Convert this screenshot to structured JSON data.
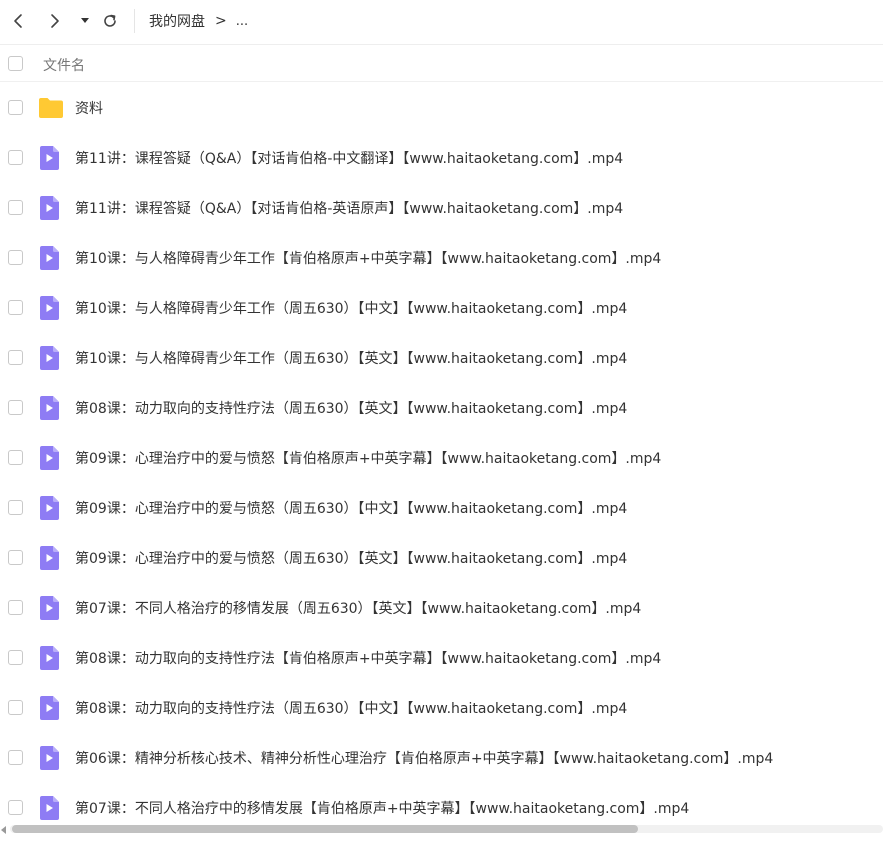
{
  "toolbar": {
    "breadcrumb_root": "我的网盘",
    "breadcrumb_sep": ">",
    "breadcrumb_more": "..."
  },
  "header": {
    "column_name": "文件名"
  },
  "colors": {
    "folder": "#FFC933",
    "video": "#8E7CF4",
    "scroll_thumb": "#C1C1C1"
  },
  "files": [
    {
      "name": "资料",
      "type": "folder",
      "icon": "folder-icon"
    },
    {
      "name": "第11讲：课程答疑（Q&A）【对话肯伯格-中文翻译】【www.haitaoketang.com】.mp4",
      "type": "video",
      "icon": "video-file-icon"
    },
    {
      "name": "第11讲：课程答疑（Q&A）【对话肯伯格-英语原声】【www.haitaoketang.com】.mp4",
      "type": "video",
      "icon": "video-file-icon"
    },
    {
      "name": "第10课：与人格障碍青少年工作【肯伯格原声+中英字幕】【www.haitaoketang.com】.mp4",
      "type": "video",
      "icon": "video-file-icon"
    },
    {
      "name": "第10课：与人格障碍青少年工作（周五630）【中文】【www.haitaoketang.com】.mp4",
      "type": "video",
      "icon": "video-file-icon"
    },
    {
      "name": "第10课：与人格障碍青少年工作（周五630）【英文】【www.haitaoketang.com】.mp4",
      "type": "video",
      "icon": "video-file-icon"
    },
    {
      "name": "第08课：动力取向的支持性疗法（周五630）【英文】【www.haitaoketang.com】.mp4",
      "type": "video",
      "icon": "video-file-icon"
    },
    {
      "name": "第09课：心理治疗中的爱与愤怒【肯伯格原声+中英字幕】【www.haitaoketang.com】.mp4",
      "type": "video",
      "icon": "video-file-icon"
    },
    {
      "name": "第09课：心理治疗中的爱与愤怒（周五630）【中文】【www.haitaoketang.com】.mp4",
      "type": "video",
      "icon": "video-file-icon"
    },
    {
      "name": "第09课：心理治疗中的爱与愤怒（周五630）【英文】【www.haitaoketang.com】.mp4",
      "type": "video",
      "icon": "video-file-icon"
    },
    {
      "name": "第07课：不同人格治疗的移情发展（周五630）【英文】【www.haitaoketang.com】.mp4",
      "type": "video",
      "icon": "video-file-icon"
    },
    {
      "name": "第08课：动力取向的支持性疗法【肯伯格原声+中英字幕】【www.haitaoketang.com】.mp4",
      "type": "video",
      "icon": "video-file-icon"
    },
    {
      "name": "第08课：动力取向的支持性疗法（周五630）【中文】【www.haitaoketang.com】.mp4",
      "type": "video",
      "icon": "video-file-icon"
    },
    {
      "name": "第06课：精神分析核心技术、精神分析性心理治疗【肯伯格原声+中英字幕】【www.haitaoketang.com】.mp4",
      "type": "video",
      "icon": "video-file-icon"
    },
    {
      "name": "第07课：不同人格治疗中的移情发展【肯伯格原声+中英字幕】【www.haitaoketang.com】.mp4",
      "type": "video",
      "icon": "video-file-icon"
    }
  ],
  "scroll": {
    "horizontal_thumb_fraction": 0.72
  }
}
